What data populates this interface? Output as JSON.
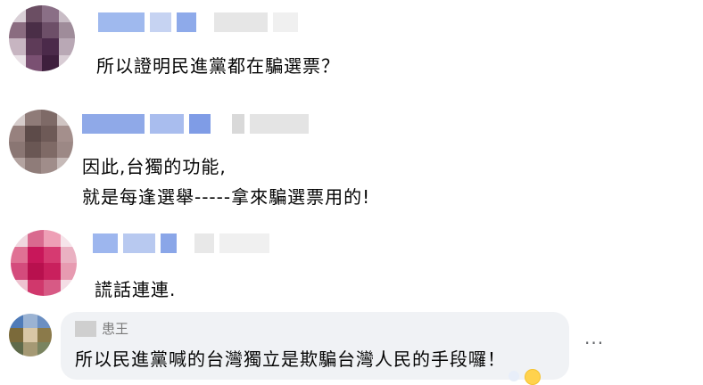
{
  "comments": [
    {
      "text": "所以證明民進黨都在騙選票？"
    },
    {
      "line1": "因此,台獨的功能,",
      "line2": "就是每逢選舉-----拿來騙選票用的!"
    },
    {
      "text": "謊話連連."
    },
    {
      "name_fragment": "患王",
      "text": "所以民進黨喊的台灣獨立是欺騙台灣人民的手段囉！"
    }
  ],
  "more_options": "···"
}
